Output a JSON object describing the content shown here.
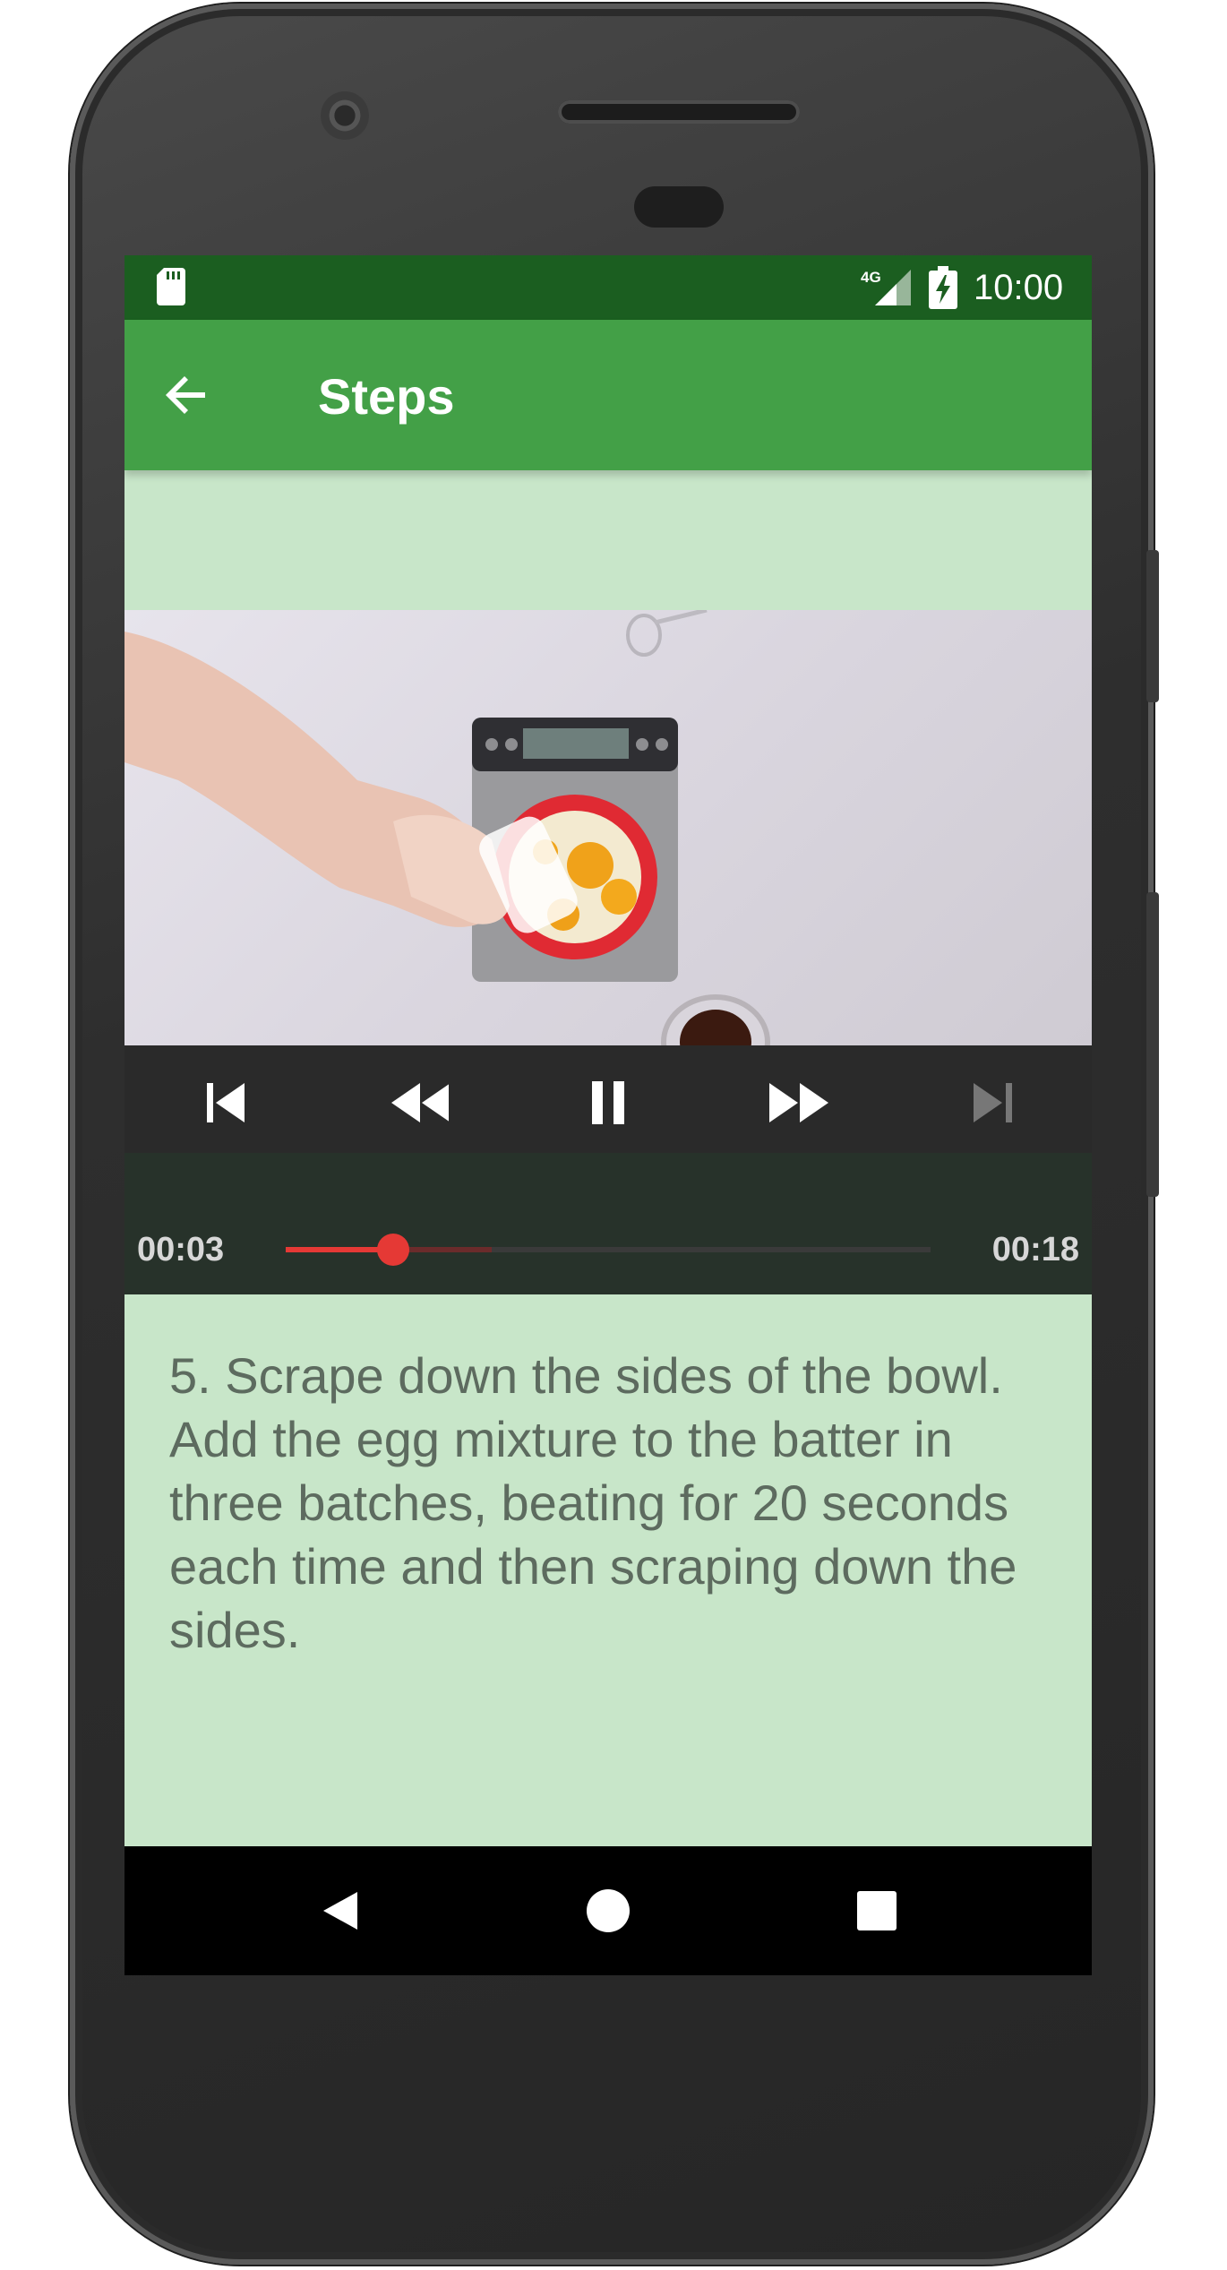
{
  "status_bar": {
    "network": "4G",
    "time": "10:00"
  },
  "toolbar": {
    "title": "Steps"
  },
  "player": {
    "position": "00:03",
    "duration": "00:18",
    "progress": 0.167,
    "buffered": 0.32
  },
  "step": {
    "description": "5. Scrape down the sides of the bowl. Add the egg mixture to the batter in three batches, beating for 20 seconds each time and then scraping down the sides."
  },
  "colors": {
    "status_bar": "#1b5e20",
    "toolbar": "#43a047",
    "background": "#c8e6c9",
    "seek_accent": "#e53935"
  },
  "icons": {
    "status": [
      "sd-card-icon",
      "signal-icon",
      "battery-charging-icon"
    ],
    "toolbar": [
      "back-arrow-icon"
    ],
    "player": [
      "skip-previous-icon",
      "rewind-icon",
      "pause-icon",
      "fast-forward-icon",
      "skip-next-icon"
    ],
    "nav": [
      "nav-back-icon",
      "nav-home-icon",
      "nav-recents-icon"
    ]
  }
}
